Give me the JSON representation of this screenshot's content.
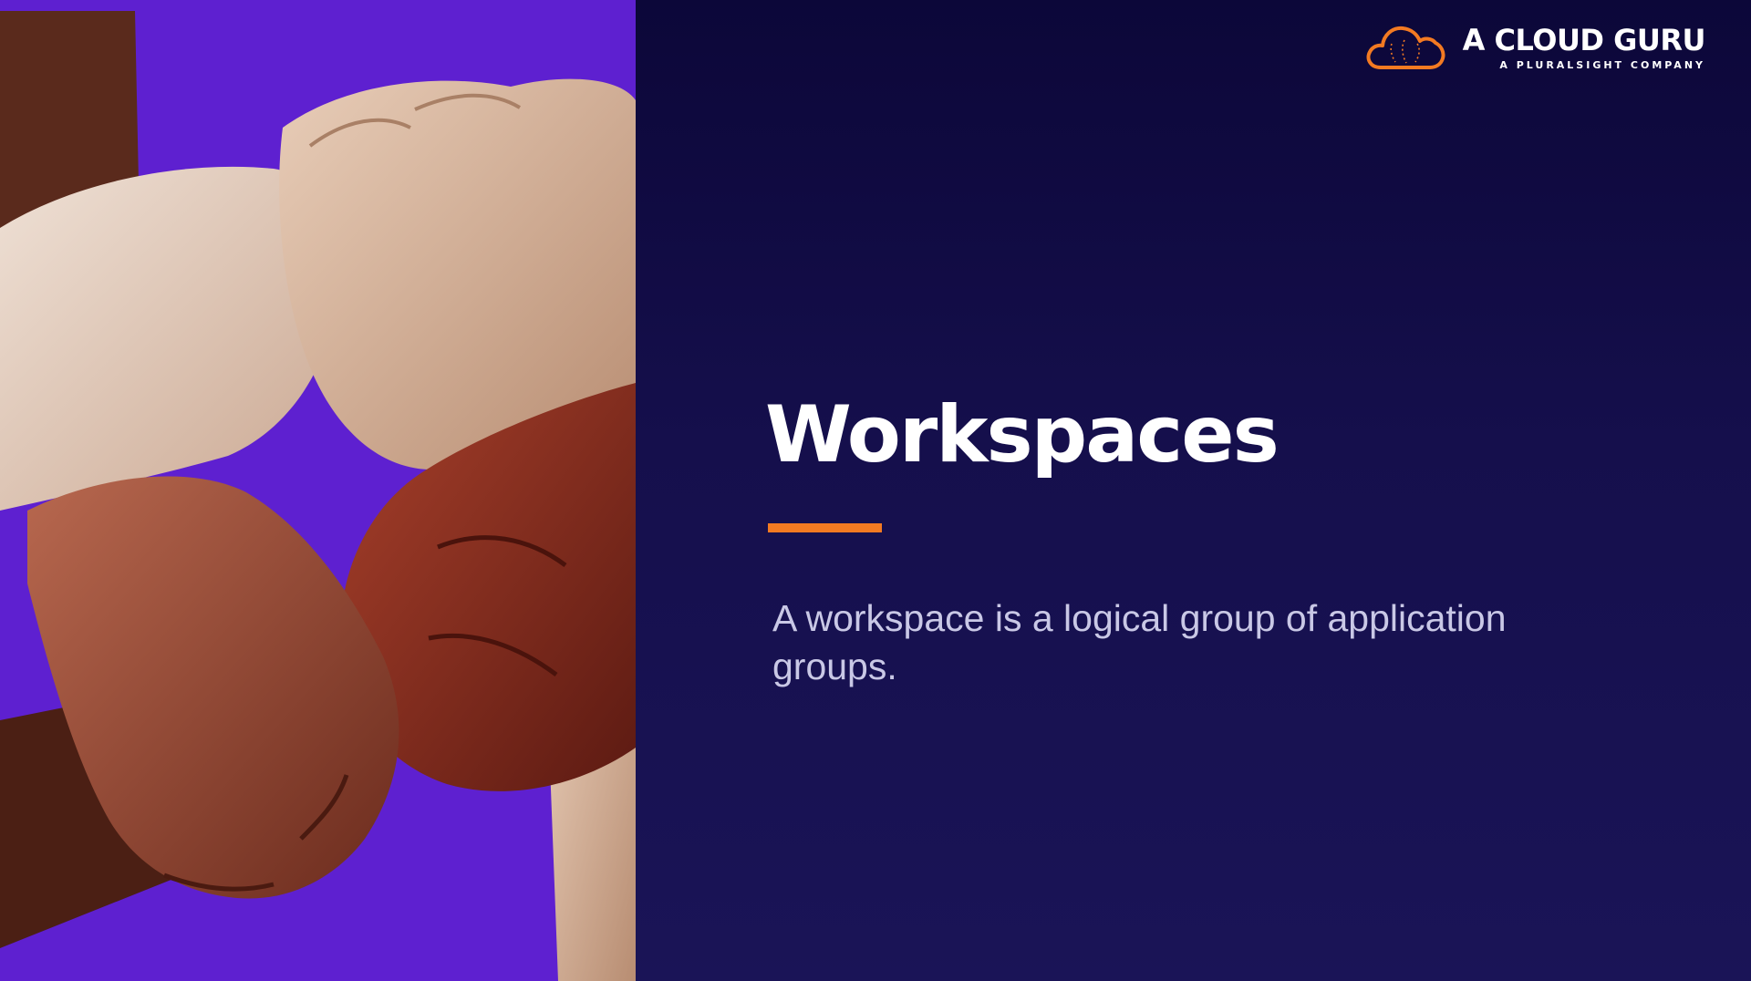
{
  "slide": {
    "title": "Workspaces",
    "description": "A workspace is a logical group of application groups."
  },
  "brand": {
    "name": "A CLOUD GURU",
    "tagline": "A PLURALSIGHT COMPANY",
    "icon": "cloud-logo-icon"
  },
  "image": {
    "subject": "four-interlocking-hands-photo"
  },
  "colors": {
    "accent": "#f37a22",
    "photo_background": "#5e20d0",
    "panel_background": "#150f4c",
    "title_text": "#ffffff",
    "body_text": "#c9c8e6"
  }
}
